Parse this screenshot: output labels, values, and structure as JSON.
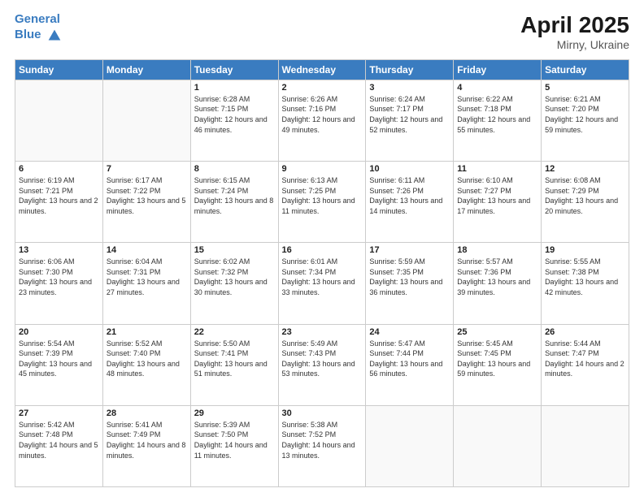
{
  "header": {
    "logo_line1": "General",
    "logo_line2": "Blue",
    "month": "April 2025",
    "location": "Mirny, Ukraine"
  },
  "weekdays": [
    "Sunday",
    "Monday",
    "Tuesday",
    "Wednesday",
    "Thursday",
    "Friday",
    "Saturday"
  ],
  "weeks": [
    [
      {
        "day": "",
        "info": ""
      },
      {
        "day": "",
        "info": ""
      },
      {
        "day": "1",
        "info": "Sunrise: 6:28 AM\nSunset: 7:15 PM\nDaylight: 12 hours and 46 minutes."
      },
      {
        "day": "2",
        "info": "Sunrise: 6:26 AM\nSunset: 7:16 PM\nDaylight: 12 hours and 49 minutes."
      },
      {
        "day": "3",
        "info": "Sunrise: 6:24 AM\nSunset: 7:17 PM\nDaylight: 12 hours and 52 minutes."
      },
      {
        "day": "4",
        "info": "Sunrise: 6:22 AM\nSunset: 7:18 PM\nDaylight: 12 hours and 55 minutes."
      },
      {
        "day": "5",
        "info": "Sunrise: 6:21 AM\nSunset: 7:20 PM\nDaylight: 12 hours and 59 minutes."
      }
    ],
    [
      {
        "day": "6",
        "info": "Sunrise: 6:19 AM\nSunset: 7:21 PM\nDaylight: 13 hours and 2 minutes."
      },
      {
        "day": "7",
        "info": "Sunrise: 6:17 AM\nSunset: 7:22 PM\nDaylight: 13 hours and 5 minutes."
      },
      {
        "day": "8",
        "info": "Sunrise: 6:15 AM\nSunset: 7:24 PM\nDaylight: 13 hours and 8 minutes."
      },
      {
        "day": "9",
        "info": "Sunrise: 6:13 AM\nSunset: 7:25 PM\nDaylight: 13 hours and 11 minutes."
      },
      {
        "day": "10",
        "info": "Sunrise: 6:11 AM\nSunset: 7:26 PM\nDaylight: 13 hours and 14 minutes."
      },
      {
        "day": "11",
        "info": "Sunrise: 6:10 AM\nSunset: 7:27 PM\nDaylight: 13 hours and 17 minutes."
      },
      {
        "day": "12",
        "info": "Sunrise: 6:08 AM\nSunset: 7:29 PM\nDaylight: 13 hours and 20 minutes."
      }
    ],
    [
      {
        "day": "13",
        "info": "Sunrise: 6:06 AM\nSunset: 7:30 PM\nDaylight: 13 hours and 23 minutes."
      },
      {
        "day": "14",
        "info": "Sunrise: 6:04 AM\nSunset: 7:31 PM\nDaylight: 13 hours and 27 minutes."
      },
      {
        "day": "15",
        "info": "Sunrise: 6:02 AM\nSunset: 7:32 PM\nDaylight: 13 hours and 30 minutes."
      },
      {
        "day": "16",
        "info": "Sunrise: 6:01 AM\nSunset: 7:34 PM\nDaylight: 13 hours and 33 minutes."
      },
      {
        "day": "17",
        "info": "Sunrise: 5:59 AM\nSunset: 7:35 PM\nDaylight: 13 hours and 36 minutes."
      },
      {
        "day": "18",
        "info": "Sunrise: 5:57 AM\nSunset: 7:36 PM\nDaylight: 13 hours and 39 minutes."
      },
      {
        "day": "19",
        "info": "Sunrise: 5:55 AM\nSunset: 7:38 PM\nDaylight: 13 hours and 42 minutes."
      }
    ],
    [
      {
        "day": "20",
        "info": "Sunrise: 5:54 AM\nSunset: 7:39 PM\nDaylight: 13 hours and 45 minutes."
      },
      {
        "day": "21",
        "info": "Sunrise: 5:52 AM\nSunset: 7:40 PM\nDaylight: 13 hours and 48 minutes."
      },
      {
        "day": "22",
        "info": "Sunrise: 5:50 AM\nSunset: 7:41 PM\nDaylight: 13 hours and 51 minutes."
      },
      {
        "day": "23",
        "info": "Sunrise: 5:49 AM\nSunset: 7:43 PM\nDaylight: 13 hours and 53 minutes."
      },
      {
        "day": "24",
        "info": "Sunrise: 5:47 AM\nSunset: 7:44 PM\nDaylight: 13 hours and 56 minutes."
      },
      {
        "day": "25",
        "info": "Sunrise: 5:45 AM\nSunset: 7:45 PM\nDaylight: 13 hours and 59 minutes."
      },
      {
        "day": "26",
        "info": "Sunrise: 5:44 AM\nSunset: 7:47 PM\nDaylight: 14 hours and 2 minutes."
      }
    ],
    [
      {
        "day": "27",
        "info": "Sunrise: 5:42 AM\nSunset: 7:48 PM\nDaylight: 14 hours and 5 minutes."
      },
      {
        "day": "28",
        "info": "Sunrise: 5:41 AM\nSunset: 7:49 PM\nDaylight: 14 hours and 8 minutes."
      },
      {
        "day": "29",
        "info": "Sunrise: 5:39 AM\nSunset: 7:50 PM\nDaylight: 14 hours and 11 minutes."
      },
      {
        "day": "30",
        "info": "Sunrise: 5:38 AM\nSunset: 7:52 PM\nDaylight: 14 hours and 13 minutes."
      },
      {
        "day": "",
        "info": ""
      },
      {
        "day": "",
        "info": ""
      },
      {
        "day": "",
        "info": ""
      }
    ]
  ]
}
